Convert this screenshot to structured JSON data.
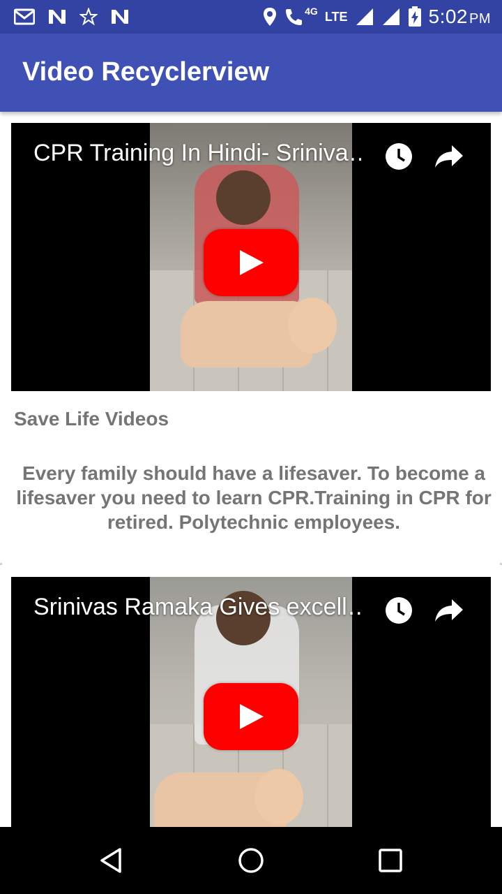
{
  "status_bar": {
    "time": "5:02",
    "ampm": "PM",
    "network_label": "LTE",
    "network_sub": "4G",
    "icons": [
      "gmail-icon",
      "n-app-icon",
      "star-icon",
      "n-app-icon",
      "location-icon",
      "wifi-call-icon",
      "signal-icon",
      "signal-icon",
      "battery-charging-icon"
    ]
  },
  "toolbar": {
    "title": "Video Recyclerview",
    "color": "#3f51b5"
  },
  "cards": [
    {
      "video_title": "CPR Training In Hindi- Sriniva…",
      "heading": "Save Life Videos",
      "description": "Every family should have a lifesaver. To become a lifesaver you need to learn CPR.Training in CPR for retired. Polytechnic employees."
    },
    {
      "video_title": "Srinivas Ramaka Gives excell…"
    }
  ],
  "colors": {
    "status_bar": "#3343a3",
    "accent_red": "#ff0000",
    "text_grey": "#757575"
  },
  "navbar": {
    "icons": [
      "back-icon",
      "home-icon",
      "recents-icon"
    ]
  }
}
